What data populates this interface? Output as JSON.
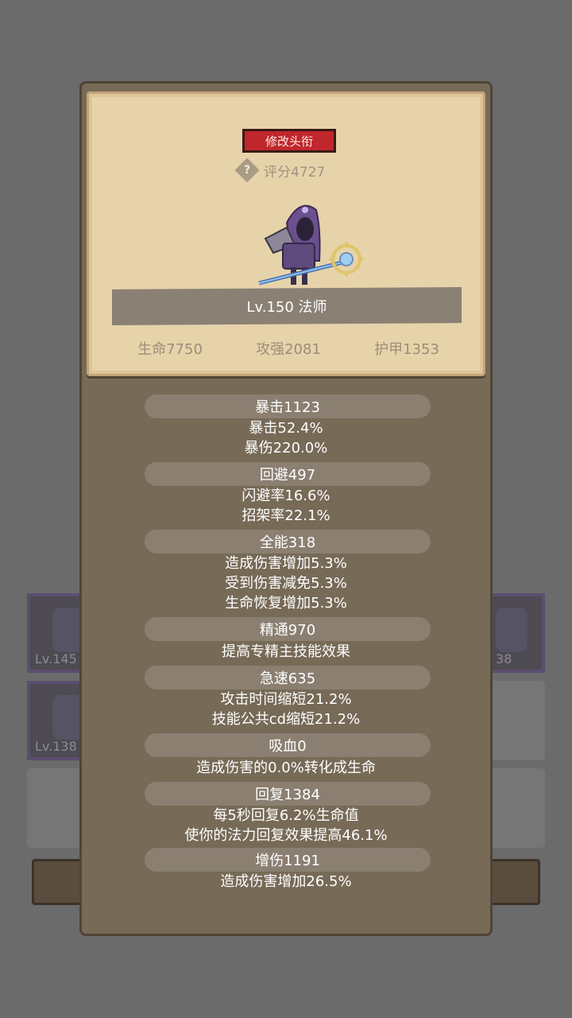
{
  "background": {
    "slots": [
      {
        "level": "Lv.145"
      },
      {
        "level": "38"
      },
      {
        "level": "Lv.138"
      }
    ]
  },
  "popup": {
    "rename_button": "修改头衔",
    "help_icon_glyph": "?",
    "score": "评分4727",
    "level_class": "Lv.150 法师",
    "stats": [
      "生命7750",
      "攻强2081",
      "护甲1353"
    ],
    "groups": [
      {
        "title": "暴击1123",
        "lines": [
          "暴击52.4%",
          "暴伤220.0%"
        ]
      },
      {
        "title": "回避497",
        "lines": [
          "闪避率16.6%",
          "招架率22.1%"
        ]
      },
      {
        "title": "全能318",
        "lines": [
          "造成伤害增加5.3%",
          "受到伤害减免5.3%",
          "生命恢复增加5.3%"
        ]
      },
      {
        "title": "精通970",
        "lines": [
          "提高专精主技能效果"
        ]
      },
      {
        "title": "急速635",
        "lines": [
          "攻击时间缩短21.2%",
          "技能公共cd缩短21.2%"
        ]
      },
      {
        "title": "吸血0",
        "lines": [
          "造成伤害的0.0%转化成生命"
        ]
      },
      {
        "title": "回复1384",
        "lines": [
          "每5秒回复6.2%生命值",
          "使你的法力回复效果提高46.1%"
        ]
      },
      {
        "title": "增伤1191",
        "lines": [
          "造成伤害增加26.5%"
        ]
      }
    ]
  }
}
